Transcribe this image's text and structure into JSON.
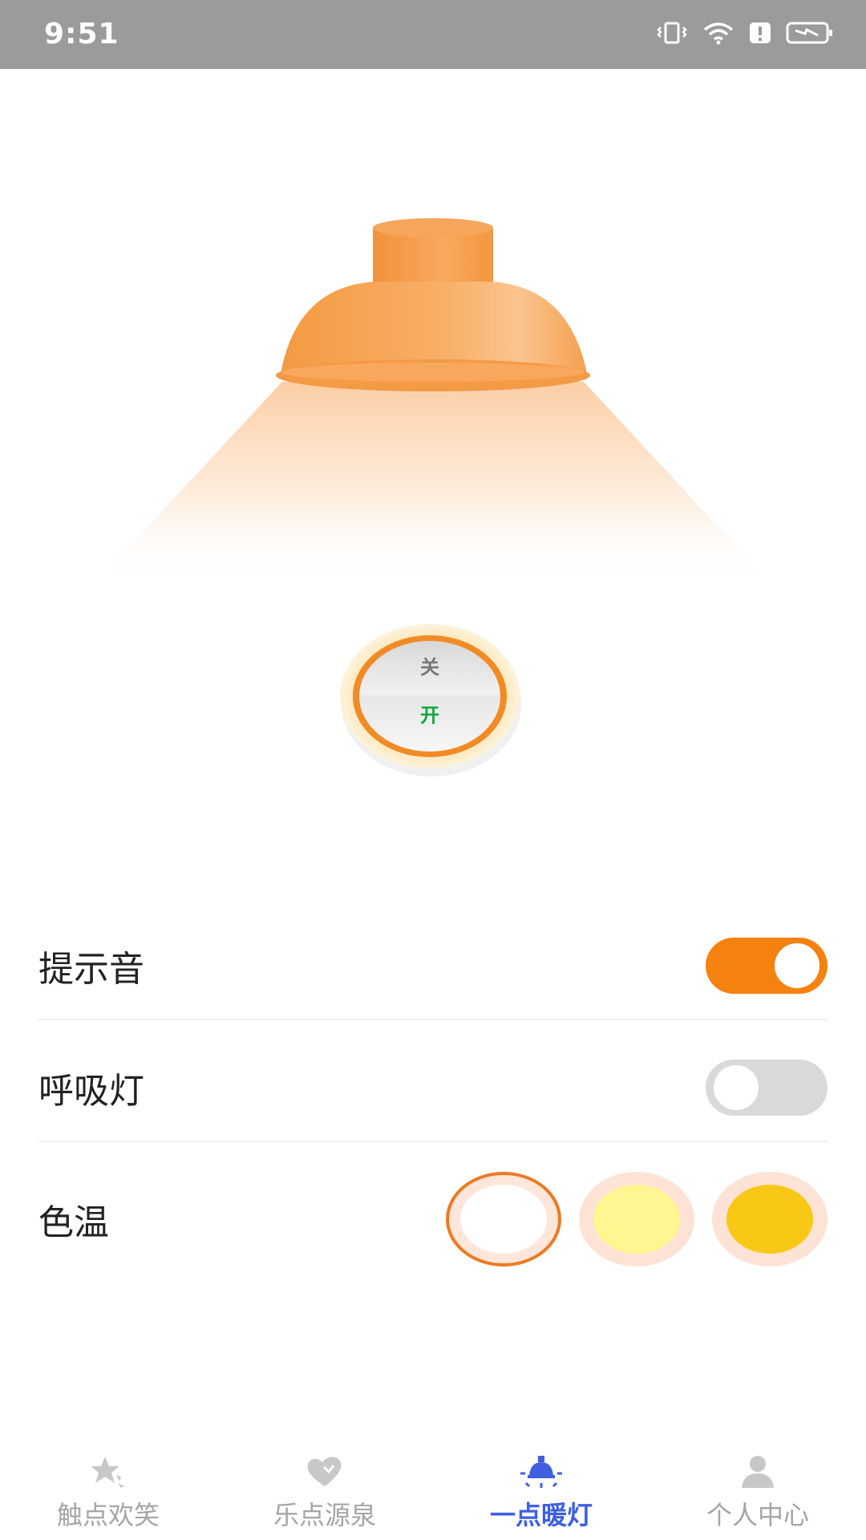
{
  "status_bar": {
    "time": "9:51"
  },
  "lamp": {
    "shade_color": "#f59a43",
    "light_color": "#fde2c8"
  },
  "power_switch": {
    "off_label": "关",
    "on_label": "开"
  },
  "settings": {
    "sound": {
      "label": "提示音",
      "enabled": true
    },
    "breathing_light": {
      "label": "呼吸灯",
      "enabled": false
    },
    "color_temperature": {
      "label": "色温",
      "options": [
        {
          "color": "#ffffff",
          "selected": true
        },
        {
          "color": "#fff691",
          "selected": false
        },
        {
          "color": "#f9c817",
          "selected": false
        }
      ]
    }
  },
  "bottom_nav": {
    "items": [
      {
        "label": "触点欢笑",
        "icon": "star-icon",
        "active": false
      },
      {
        "label": "乐点源泉",
        "icon": "heart-icon",
        "active": false
      },
      {
        "label": "一点暖灯",
        "icon": "lamp-icon",
        "active": true
      },
      {
        "label": "个人中心",
        "icon": "person-icon",
        "active": false
      }
    ]
  },
  "colors": {
    "accent_orange": "#f5820f",
    "nav_active": "#3f5fe0",
    "nav_inactive": "#a5a5a5"
  }
}
